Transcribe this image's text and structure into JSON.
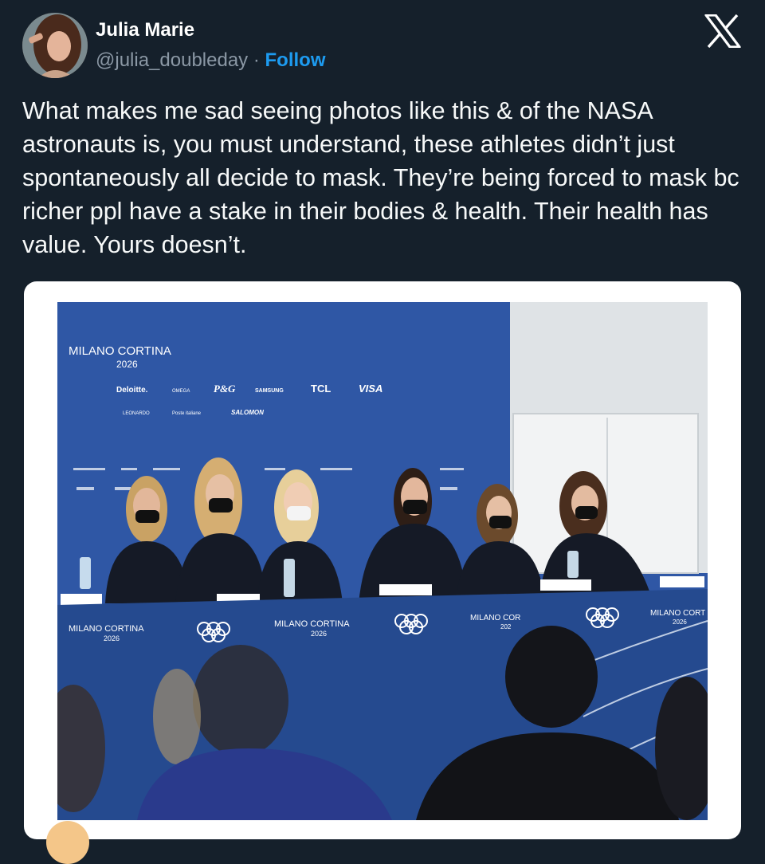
{
  "tweet": {
    "display_name": "Julia Marie",
    "handle": "@julia_doubleday",
    "separator": " · ",
    "follow_label": "Follow",
    "text": "What makes me sad seeing photos like this & of the NASA astronauts is, you must understand, these athletes didn’t just spontaneously all decide to mask. They’re being forced to mask bc richer ppl have a stake in their bodies & health. Their health has value. Yours doesn’t."
  },
  "icons": {
    "platform_logo": "x-logo-icon"
  },
  "photo": {
    "backdrop_title": "MILANO CORTINA",
    "backdrop_year": "2026",
    "sponsors_row1": [
      "Deloitte.",
      "OMEGA",
      "P&G",
      "SAMSUNG",
      "TCL",
      "VISA"
    ],
    "sponsors_row2": [
      "LEONARDO",
      "Poste italiane",
      "SALOMON"
    ],
    "table_banner": [
      {
        "title": "MILANO CORTINA",
        "year": "2026"
      },
      {
        "title": "MILANO CORTINA",
        "year": "2026"
      },
      {
        "title": "MILANO COR",
        "year": "202"
      },
      {
        "title": "MILANO CORT",
        "year": "2026"
      }
    ]
  },
  "colors": {
    "background": "#15202b",
    "text": "#f7f9f9",
    "secondary_text": "#8b98a5",
    "accent": "#1d9bf0",
    "backdrop_blue": "#2f57a5",
    "table_blue": "#254a8f"
  }
}
